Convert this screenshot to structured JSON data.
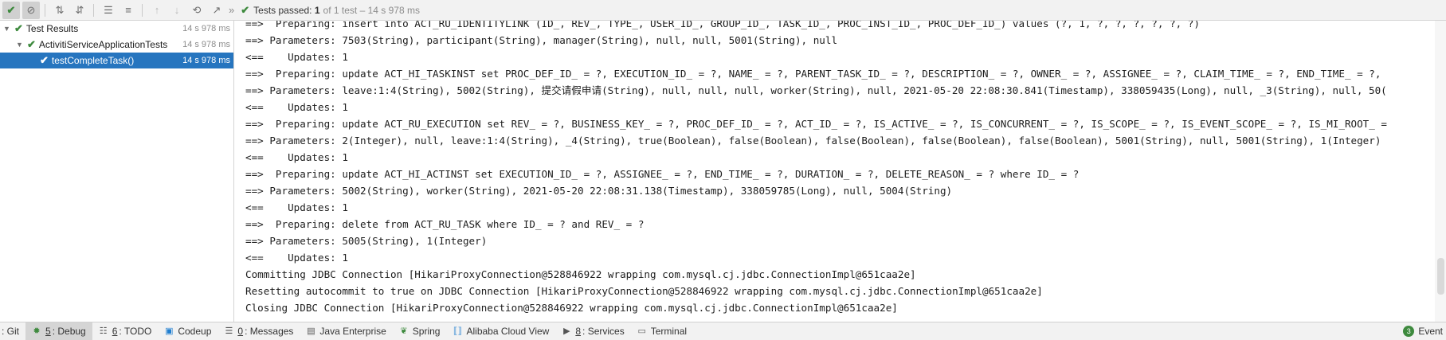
{
  "toolbar": {
    "icons": [
      "check-icon",
      "stop-icon",
      "sort-alpha-icon",
      "sort-duration-icon",
      "expand-all-icon",
      "collapse-all-icon",
      "up-arrow-icon",
      "down-arrow-icon",
      "history-icon",
      "export-icon"
    ],
    "more": "»",
    "status_bold": "Tests passed:",
    "status_count": "1",
    "status_tail": "of 1 test – 14 s 978 ms"
  },
  "tree": {
    "rows": [
      {
        "label": "Test Results",
        "time": "14 s 978 ms"
      },
      {
        "label": "ActivitiServiceApplicationTests",
        "time": "14 s 978 ms"
      },
      {
        "label": "testCompleteTask()",
        "time": "14 s 978 ms"
      }
    ]
  },
  "console": {
    "lines": [
      "==>  Preparing: insert into ACT_RU_IDENTITYLINK (ID_, REV_, TYPE_, USER_ID_, GROUP_ID_, TASK_ID_, PROC_INST_ID_, PROC_DEF_ID_) values (?, 1, ?, ?, ?, ?, ?, ?)",
      "==> Parameters: 7503(String), participant(String), manager(String), null, null, 5001(String), null",
      "<==    Updates: 1",
      "==>  Preparing: update ACT_HI_TASKINST set PROC_DEF_ID_ = ?, EXECUTION_ID_ = ?, NAME_ = ?, PARENT_TASK_ID_ = ?, DESCRIPTION_ = ?, OWNER_ = ?, ASSIGNEE_ = ?, CLAIM_TIME_ = ?, END_TIME_ = ?,",
      "==> Parameters: leave:1:4(String), 5002(String), 提交请假申请(String), null, null, null, worker(String), null, 2021-05-20 22:08:30.841(Timestamp), 338059435(Long), null, _3(String), null, 50(",
      "<==    Updates: 1",
      "==>  Preparing: update ACT_RU_EXECUTION set REV_ = ?, BUSINESS_KEY_ = ?, PROC_DEF_ID_ = ?, ACT_ID_ = ?, IS_ACTIVE_ = ?, IS_CONCURRENT_ = ?, IS_SCOPE_ = ?, IS_EVENT_SCOPE_ = ?, IS_MI_ROOT_ =",
      "==> Parameters: 2(Integer), null, leave:1:4(String), _4(String), true(Boolean), false(Boolean), false(Boolean), false(Boolean), false(Boolean), 5001(String), null, 5001(String), 1(Integer)",
      "<==    Updates: 1",
      "==>  Preparing: update ACT_HI_ACTINST set EXECUTION_ID_ = ?, ASSIGNEE_ = ?, END_TIME_ = ?, DURATION_ = ?, DELETE_REASON_ = ? where ID_ = ?",
      "==> Parameters: 5002(String), worker(String), 2021-05-20 22:08:31.138(Timestamp), 338059785(Long), null, 5004(String)",
      "<==    Updates: 1",
      "==>  Preparing: delete from ACT_RU_TASK where ID_ = ? and REV_ = ?",
      "==> Parameters: 5005(String), 1(Integer)",
      "<==    Updates: 1",
      "Committing JDBC Connection [HikariProxyConnection@528846922 wrapping com.mysql.cj.jdbc.ConnectionImpl@651caa2e]",
      "Resetting autocommit to true on JDBC Connection [HikariProxyConnection@528846922 wrapping com.mysql.cj.jdbc.ConnectionImpl@651caa2e]",
      "Closing JDBC Connection [HikariProxyConnection@528846922 wrapping com.mysql.cj.jdbc.ConnectionImpl@651caa2e]"
    ]
  },
  "bottom_tabs": [
    {
      "num": "",
      "label": ": Git",
      "icon": "git-icon"
    },
    {
      "num": "5",
      "label": ": Debug",
      "icon": "debug-icon",
      "active": true
    },
    {
      "num": "6",
      "label": ": TODO",
      "icon": "todo-icon"
    },
    {
      "num": "",
      "label": "Codeup",
      "icon": "codeup-icon"
    },
    {
      "num": "0",
      "label": ": Messages",
      "icon": "messages-icon"
    },
    {
      "num": "",
      "label": "Java Enterprise",
      "icon": "java-enterprise-icon"
    },
    {
      "num": "",
      "label": "Spring",
      "icon": "spring-icon"
    },
    {
      "num": "",
      "label": "Alibaba Cloud View",
      "icon": "alibaba-cloud-icon"
    },
    {
      "num": "8",
      "label": ": Services",
      "icon": "services-icon"
    },
    {
      "num": "",
      "label": "Terminal",
      "icon": "terminal-icon"
    }
  ],
  "event_log": {
    "badge": "3",
    "label": "Event"
  },
  "colors": {
    "accent": "#2675bf",
    "pass": "#3e8a3e"
  }
}
